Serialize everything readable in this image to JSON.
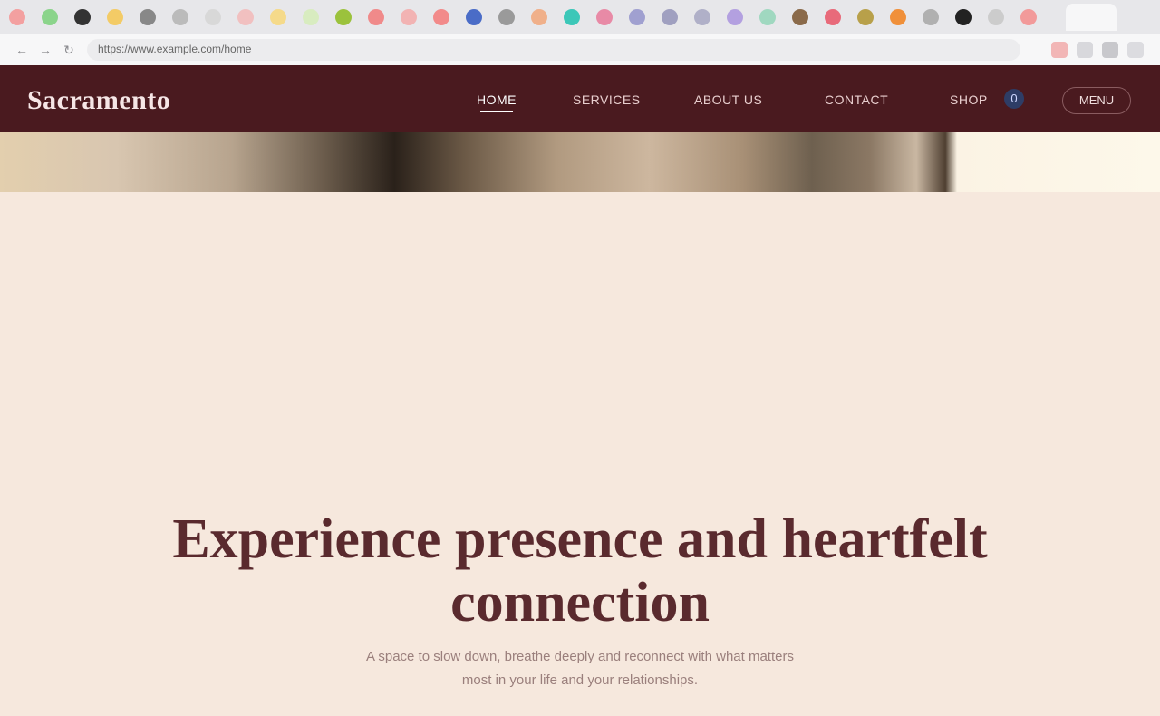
{
  "browser": {
    "url": "https://www.example.com/home",
    "tab_colors": [
      "#f3a0a0",
      "#8bd48b",
      "#333333",
      "#f3cb66",
      "#888888",
      "#bbbbbb",
      "#d8d8d8",
      "#f1c0c0",
      "#f5da8a",
      "#d8ecc0",
      "#9bc23c",
      "#f08a8a",
      "#f2b3b3",
      "#f28a8a",
      "#4a6cc7",
      "#9a9a9a",
      "#f0b08a",
      "#3cc7b8",
      "#e88aa6",
      "#a0a0d0",
      "#a0a0c0",
      "#b0b0c8",
      "#b3a0e0",
      "#a0d8c0",
      "#8a6a4a",
      "#e86a7a",
      "#b8a04a",
      "#f0903a",
      "#b0b0b0",
      "#222222",
      "#cccccc",
      "#f29a9a"
    ]
  },
  "header": {
    "logo": "Sacramento",
    "nav": [
      "HOME",
      "SERVICES",
      "ABOUT US",
      "CONTACT",
      "SHOP"
    ],
    "cart_count": "0",
    "button_label": "MENU"
  },
  "hero": {
    "title": "Experience presence and heartfelt connection",
    "subtitle": "A space to slow down, breathe deeply and reconnect with what matters most in your life and your relationships."
  }
}
